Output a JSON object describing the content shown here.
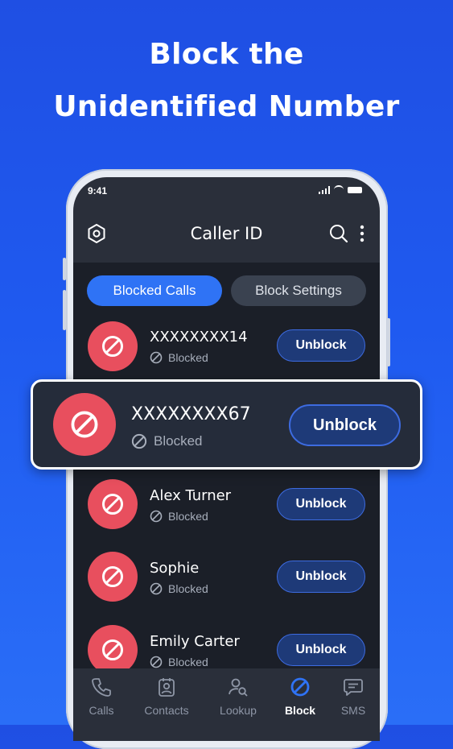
{
  "headline": {
    "line1": "Block the",
    "line2": "Unidentified Number"
  },
  "status_bar": {
    "time": "9:41"
  },
  "app_bar": {
    "title": "Caller ID",
    "left_icon": "settings-icon",
    "right_icons": [
      "search-icon",
      "more-vertical-icon"
    ]
  },
  "tabs": [
    {
      "label": "Blocked Calls",
      "active": true
    },
    {
      "label": "Block Settings",
      "active": false
    }
  ],
  "list": {
    "status_text": "Blocked",
    "action_label": "Unblock",
    "items": [
      {
        "name": "XXXXXXXX14",
        "status": "Blocked",
        "action": "Unblock"
      },
      {
        "name": "Alex Turner",
        "status": "Blocked",
        "action": "Unblock"
      },
      {
        "name": "Sophie",
        "status": "Blocked",
        "action": "Unblock"
      },
      {
        "name": "Emily Carter",
        "status": "Blocked",
        "action": "Unblock"
      }
    ]
  },
  "highlight": {
    "name": "XXXXXXXX67",
    "status": "Blocked",
    "action": "Unblock"
  },
  "bottom_nav": [
    {
      "label": "Calls",
      "icon": "phone-icon",
      "active": false
    },
    {
      "label": "Contacts",
      "icon": "contacts-icon",
      "active": false
    },
    {
      "label": "Lookup",
      "icon": "lookup-icon",
      "active": false
    },
    {
      "label": "Block",
      "icon": "block-icon",
      "active": true
    },
    {
      "label": "SMS",
      "icon": "sms-icon",
      "active": false
    }
  ],
  "colors": {
    "background": "#1f55ec",
    "accent": "#2f73f5",
    "avatar_red": "#e84f5e",
    "screen": "#1b1f28"
  }
}
